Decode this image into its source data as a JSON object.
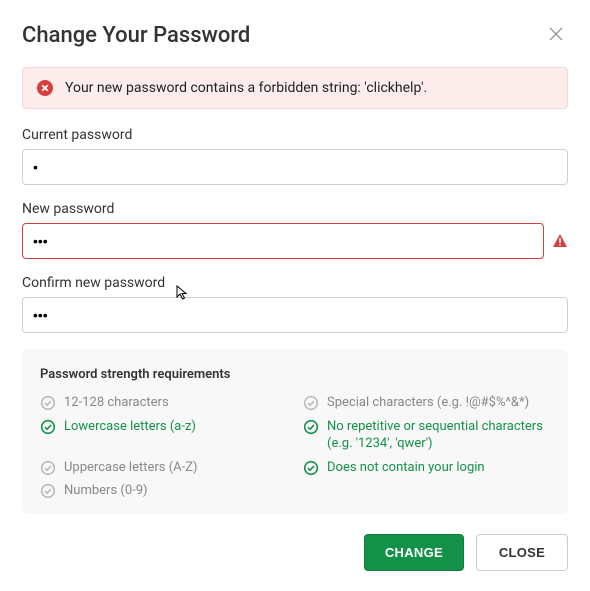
{
  "title": "Change Your Password",
  "alert": {
    "message": "Your new password contains a forbidden string: 'clickhelp'."
  },
  "fields": {
    "current": {
      "label": "Current password",
      "value": "•"
    },
    "new": {
      "label": "New password",
      "value": "•••",
      "error": true
    },
    "confirm": {
      "label": "Confirm new password",
      "value": "•••"
    }
  },
  "requirements": {
    "title": "Password strength requirements",
    "items": [
      {
        "text": "12-128 characters",
        "met": false
      },
      {
        "text": "Special characters (e.g. !@#$%^&*)",
        "met": false
      },
      {
        "text": "Lowercase letters (a-z)",
        "met": true
      },
      {
        "text": "No repetitive or sequential characters (e.g. '1234', 'qwer')",
        "met": true
      },
      {
        "text": "Uppercase letters (A-Z)",
        "met": false
      },
      {
        "text": "Does not contain your login",
        "met": true
      },
      {
        "text": "Numbers (0-9)",
        "met": false
      }
    ]
  },
  "buttons": {
    "primary": "CHANGE",
    "secondary": "CLOSE"
  },
  "colors": {
    "accent": "#149149",
    "error": "#d63d3d",
    "alertBg": "#fdecec"
  }
}
